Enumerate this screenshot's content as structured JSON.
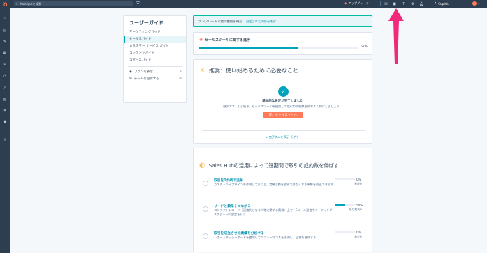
{
  "topbar": {
    "search_placeholder": "HubSpotを検索",
    "upgrade_label": "アップグレード",
    "copilot_label": "Copilot",
    "icons": [
      "phone-icon",
      "marketplace-icon",
      "help-icon",
      "settings-icon",
      "notifications-icon"
    ]
  },
  "rail": {
    "icons": [
      "bookmark-icon",
      "contacts-icon",
      "marketing-icon",
      "content-icon",
      "sales-icon",
      "service-icon",
      "automation-icon",
      "reporting-icon",
      "data-icon",
      "commerce-icon",
      "library-icon"
    ]
  },
  "guide": {
    "title": "ユーザーガイド",
    "items": [
      {
        "label": "マーケティングガイド",
        "active": false
      },
      {
        "label": "セールスガイド",
        "active": true
      },
      {
        "label": "カスタマー サービス ガイド",
        "active": false
      },
      {
        "label": "コンテンツガイド",
        "active": false
      },
      {
        "label": "コマースガイド",
        "active": false
      }
    ],
    "plan_link": "プランを表示",
    "invite_link": "チームを招待する"
  },
  "banner": {
    "text": "テンプレートで他の機能を確認",
    "link": "設定された内容を確認"
  },
  "progress": {
    "title": "セールスツールに関する進捗",
    "percent_label": "62%",
    "value": 0.62
  },
  "recommend": {
    "title": "推奨：使い始めるために必要なこと",
    "done_title": "基本的な設定が完了しました",
    "description": "順調です。引き続き、セールスツールを使用して取引の成約数を効率よく伸ばしましょう。",
    "button": "次：セールスツール",
    "completed_toggle": "完了済みを表示（1件）"
  },
  "sales": {
    "title": "Sales Hubの活用によって短期間で取引の成約数を伸ばす",
    "tasks": [
      {
        "title": "取引を1か所で追跡",
        "description": "カスタムパイプラインを作成しておくと、営業活動を追跡できなくなる事態を防止できます",
        "percent": "0%",
        "value": 0,
        "time": "約4分"
      },
      {
        "title": "リードと素早くつながる",
        "description": "コンタクトレコード（連絡先となる人物に関する情報）上で、Eメール送信やミーティングスケジュール設定を行う",
        "percent": "50%",
        "value": 0.5,
        "time": "残り約3分"
      },
      {
        "title": "取引を成立させて業績を分析する",
        "description": "レポートダッシュボードを使用してパフォーマンスを予測し、目標を達成する",
        "percent": "0%",
        "value": 0,
        "time": "約2分"
      }
    ]
  },
  "colors": {
    "topbar": "#2d3e50",
    "accent_teal": "#00a4bd",
    "brand_orange": "#ff7a59",
    "annotation_pink": "#f2287a"
  }
}
